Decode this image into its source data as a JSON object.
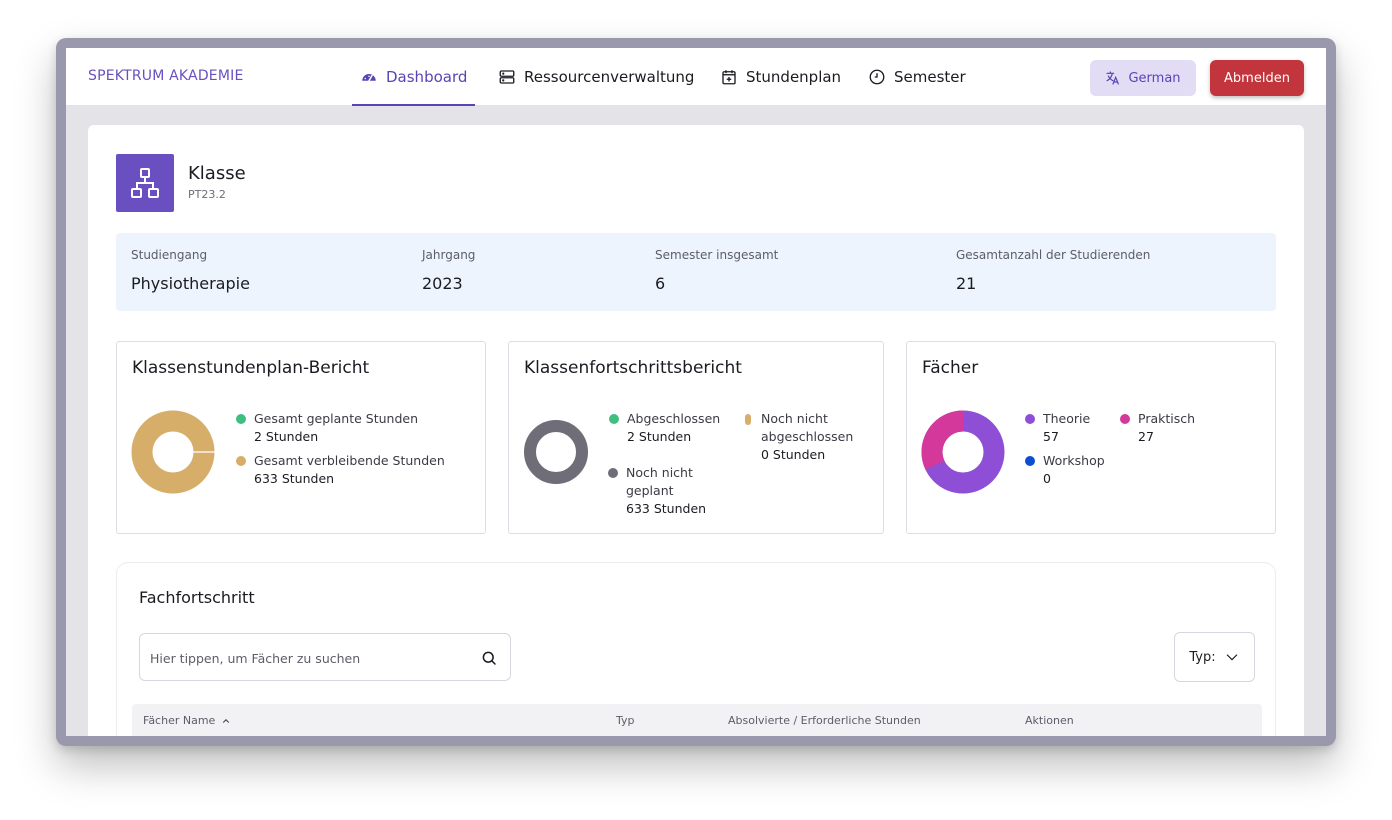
{
  "brand": "SPEKTRUM AKADEMIE",
  "nav": {
    "dashboard": "Dashboard",
    "resources": "Ressourcenverwaltung",
    "schedule": "Stundenplan",
    "semester": "Semester"
  },
  "language_button": "German",
  "logout_button": "Abmelden",
  "class_header": {
    "title": "Klasse",
    "code": "PT23.2"
  },
  "info": {
    "program_label": "Studiengang",
    "program_value": "Physiotherapie",
    "year_label": "Jahrgang",
    "year_value": "2023",
    "semesters_label": "Semester insgesamt",
    "semesters_value": "6",
    "students_label": "Gesamtanzahl der Studierenden",
    "students_value": "21"
  },
  "schedule_report": {
    "title": "Klassenstundenplan-Bericht",
    "planned_label": "Gesamt geplante Stunden",
    "planned_value": "2 Stunden",
    "remaining_label": "Gesamt verbleibende Stunden",
    "remaining_value": "633 Stunden"
  },
  "progress_report": {
    "title": "Klassenfortschrittsbericht",
    "completed_label": "Abgeschlossen",
    "completed_value": "2 Stunden",
    "not_completed_label_1": "Noch nicht",
    "not_completed_label_2": "abgeschlossen",
    "not_completed_value": "0 Stunden",
    "not_planned_label_1": "Noch nicht",
    "not_planned_label_2": "geplant",
    "not_planned_value": "633 Stunden"
  },
  "subjects": {
    "title": "Fächer",
    "theory_label": "Theorie",
    "theory_value": "57",
    "practical_label": "Praktisch",
    "practical_value": "27",
    "workshop_label": "Workshop",
    "workshop_value": "0"
  },
  "subject_progress": {
    "title": "Fachfortschritt",
    "search_placeholder": "Hier tippen, um Fächer zu suchen",
    "type_filter": "Typ:",
    "columns": {
      "name": "Fächer Name",
      "type": "Typ",
      "hours": "Absolvierte / Erforderliche Stunden",
      "actions": "Aktionen"
    }
  },
  "colors": {
    "accent": "#5b43b6",
    "brand": "#6a4fc1",
    "logout": "#c3353c",
    "green": "#3fbf7f",
    "gold": "#d6ae6a",
    "gray": "#6f6e78",
    "purple": "#8e4fd6",
    "magenta": "#d3389a",
    "blue": "#0b4fcf"
  }
}
